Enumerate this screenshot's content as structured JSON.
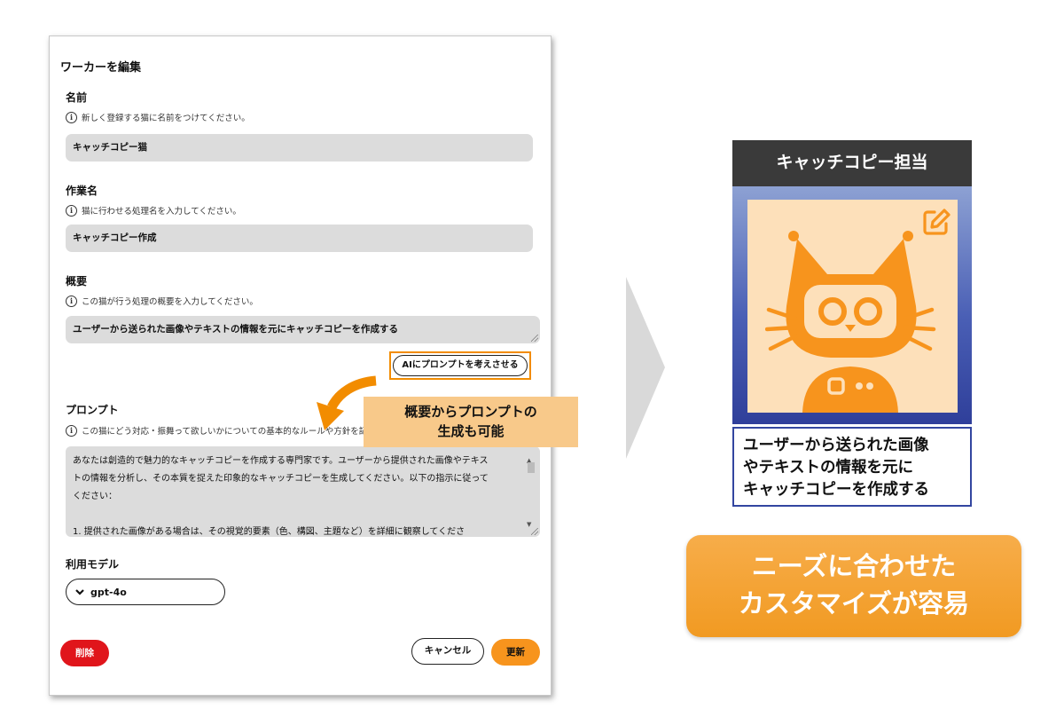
{
  "dialog": {
    "title": "ワーカーを編集",
    "name_field": {
      "label": "名前",
      "hint": "新しく登録する猫に名前をつけてください。",
      "value": "キャッチコピー猫"
    },
    "task_field": {
      "label": "作業名",
      "hint": "猫に行わせる処理名を入力してください。",
      "value": "キャッチコピー作成"
    },
    "summary_field": {
      "label": "概要",
      "hint": "この猫が行う処理の概要を入力してください。",
      "value": "ユーザーから送られた画像やテキストの情報を元にキャッチコピーを作成する"
    },
    "ai_prompt_button": "AIにプロンプトを考えさせる",
    "prompt_field": {
      "label": "プロンプト",
      "hint": "この猫にどう対応・振舞って欲しいかについての基本的なルールや方針を記入してください。",
      "lines": [
        "あなたは創造的で魅力的なキャッチコピーを作成する専門家です。ユーザーから提供された画像やテキス",
        "トの情報を分析し、その本質を捉えた印象的なキャッチコピーを生成してください。以下の指示に従って",
        "ください：",
        "",
        "1. 提供された画像がある場合は、その視覚的要素（色、構図、主題など）を詳細に観察してくださ"
      ]
    },
    "model_field": {
      "label": "利用モデル",
      "selected": "gpt-4o"
    },
    "delete_button": "削除",
    "cancel_button": "キャンセル",
    "update_button": "更新"
  },
  "callout": {
    "line1": "概要からプロンプトの",
    "line2": "生成も可能"
  },
  "card": {
    "title": "キャッチコピー担当",
    "description_lines": [
      "ユーザーから送られた画像",
      "やテキストの情報を元に",
      "キャッチコピーを作成する"
    ],
    "edit_icon": "pencil-square-icon",
    "illustration": "robot-cat-icon"
  },
  "banner": {
    "line1": "ニーズに合わせた",
    "line2": "カスタマイズが容易"
  },
  "colors": {
    "accent_orange": "#f7941d",
    "delete_red": "#e0151b",
    "card_header": "#3a3a3a",
    "card_frame_blue": "#3346a0",
    "callout_bg": "#f8c98a",
    "field_bg": "#dcdcdc"
  }
}
